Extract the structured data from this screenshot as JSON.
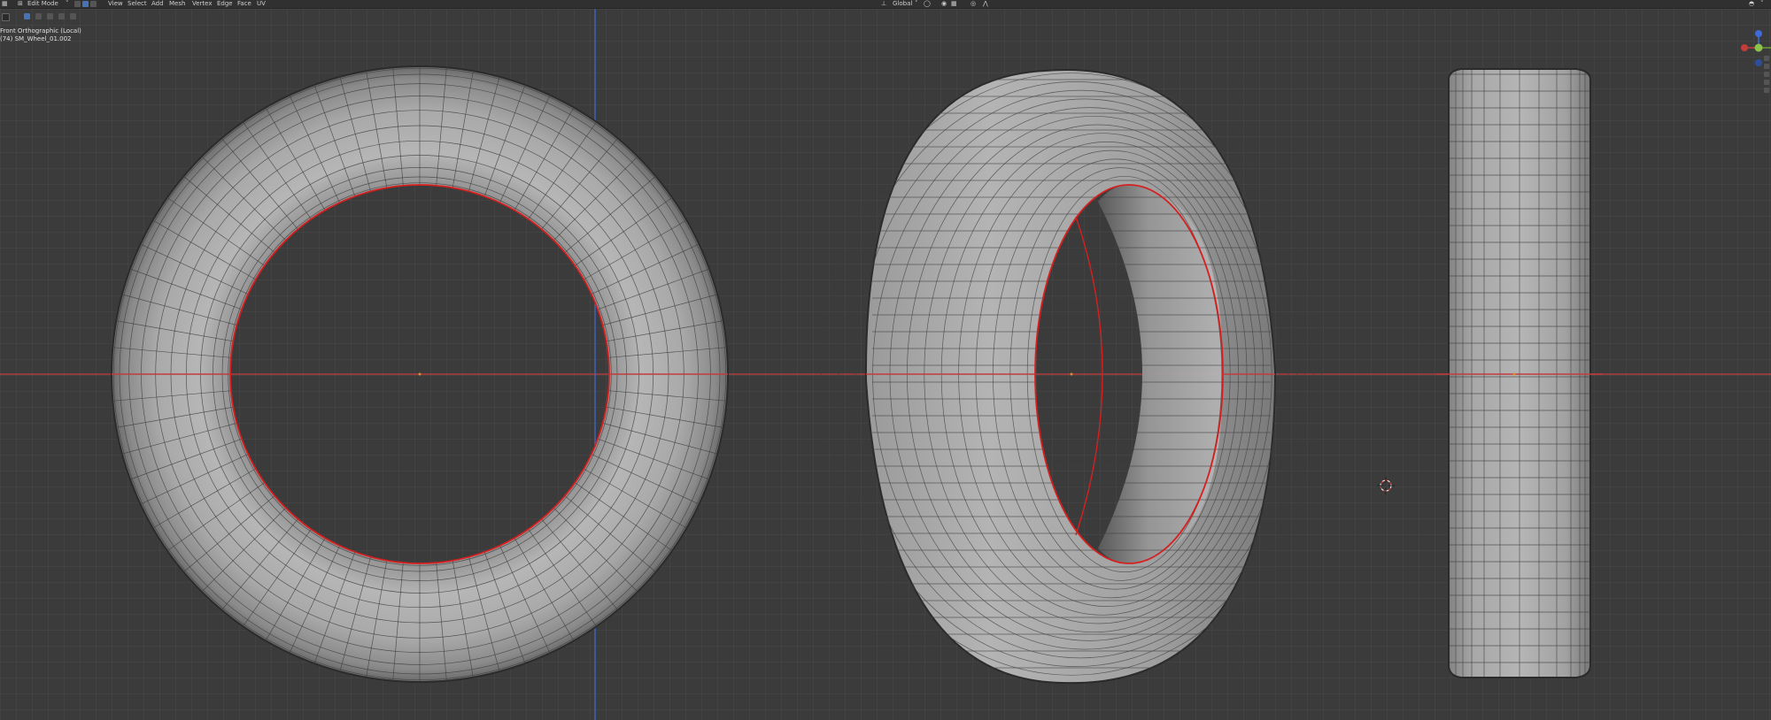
{
  "header": {
    "mode_label": "Edit Mode",
    "menus": [
      "View",
      "Select",
      "Add",
      "Mesh",
      "Vertex",
      "Edge",
      "Face",
      "UV"
    ],
    "orientation_label": "Global"
  },
  "viewport": {
    "view_name": "Front Orthographic (Local)",
    "object_info": "(74) SM_Wheel_01.002"
  },
  "colors": {
    "x_axis": "#c33c3c",
    "y_axis": "#3f6bd6",
    "seam": "#d62020",
    "accent": "#4772b3"
  },
  "icons": [
    "cursor-icon",
    "vertex-select-icon",
    "edge-select-icon",
    "face-select-icon",
    "overlay-icon",
    "shading-icon",
    "navigation-gizmo-icon",
    "3d-cursor-icon"
  ]
}
